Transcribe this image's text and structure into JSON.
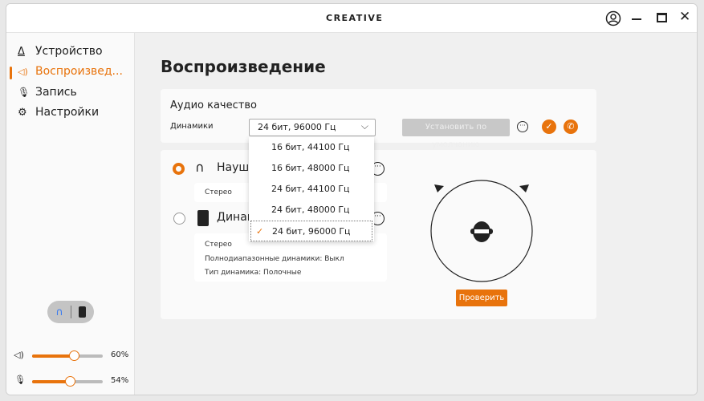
{
  "titlebar": {
    "logo": "CREATIVE"
  },
  "sidebar": {
    "items": [
      {
        "label": "Устройство",
        "icon": "device-icon"
      },
      {
        "label": "Воспроизвед...",
        "icon": "speaker-icon",
        "active": true
      },
      {
        "label": "Запись",
        "icon": "microphone-icon"
      },
      {
        "label": "Настройки",
        "icon": "gear-icon"
      }
    ],
    "output_toggle": {
      "selected": "headphones"
    },
    "volume": {
      "label": "60%",
      "value": 60
    },
    "mic": {
      "label": "54%",
      "value": 54
    }
  },
  "main": {
    "title": "Воспроизведение",
    "quality": {
      "heading": "Аудио качество",
      "label": "Динамики",
      "selected": "24 бит, 96000 Гц",
      "options": [
        "16 бит, 44100 Гц",
        "16 бит, 48000 Гц",
        "24 бит, 44100 Гц",
        "24 бит, 48000 Гц",
        "24 бит, 96000 Гц"
      ],
      "set_default": "Установить по умолчанию"
    },
    "devices": [
      {
        "name": "Наушники",
        "selected": true,
        "details": [
          "Стерео"
        ]
      },
      {
        "name": "Динамики",
        "selected": false,
        "details": [
          "Стерео",
          "Полнодиапазонные динамики: Выкл",
          "Тип динамика: Полочные"
        ]
      }
    ],
    "test_button": "Проверить"
  },
  "colors": {
    "accent": "#e8730c"
  }
}
